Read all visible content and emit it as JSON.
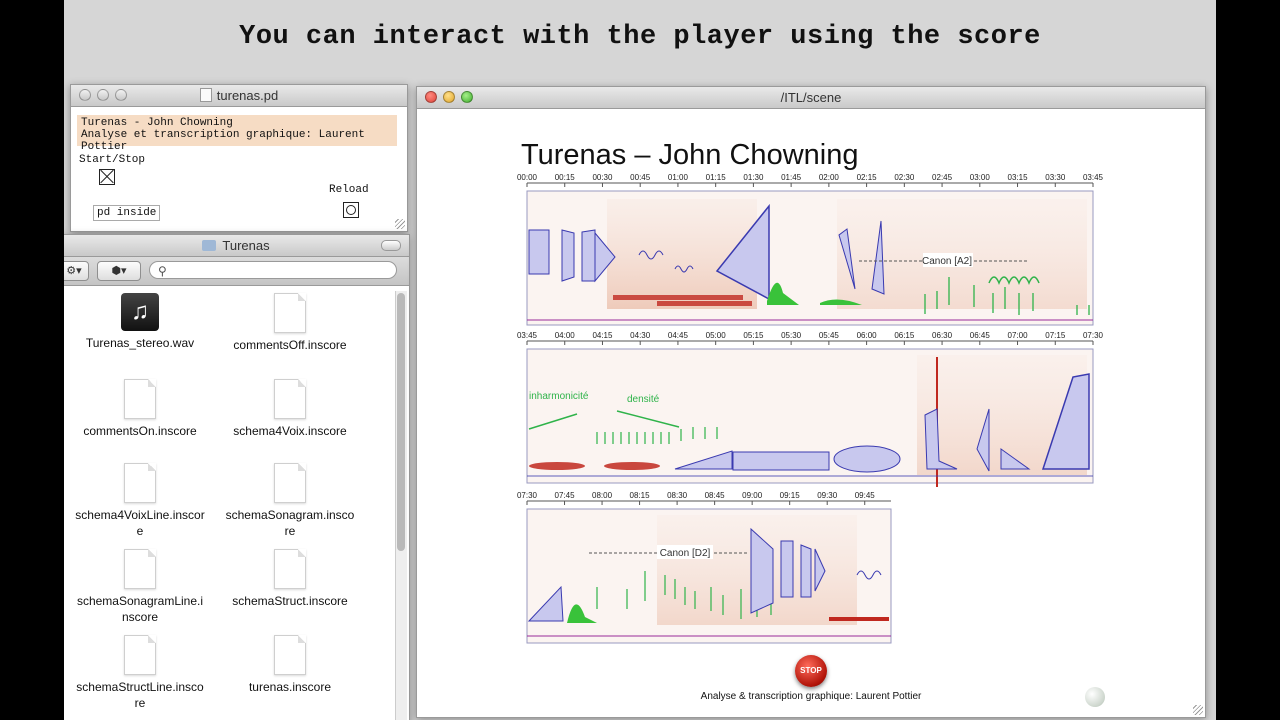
{
  "caption": "You can interact with the player using the score",
  "pd_window": {
    "title": "turenas.pd",
    "comment_line1": "Turenas - John Chowning",
    "comment_line2": "Analyse et transcription graphique: Laurent Pottier",
    "start_stop_label": "Start/Stop",
    "reload_label": "Reload",
    "object_label": "pd inside"
  },
  "finder": {
    "title": "Turenas",
    "search_placeholder": "",
    "files": [
      {
        "name": "Turenas_stereo.wav",
        "icon": "music-file-icon"
      },
      {
        "name": "commentsOff.inscore",
        "icon": "document-icon"
      },
      {
        "name": "commentsOn.inscore",
        "icon": "document-icon"
      },
      {
        "name": "schema4Voix.inscore",
        "icon": "document-icon"
      },
      {
        "name": "schema4VoixLine.inscore",
        "icon": "document-icon"
      },
      {
        "name": "schemaSonagram.inscore",
        "icon": "document-icon"
      },
      {
        "name": "schemaSonagramLine.inscore",
        "icon": "document-icon"
      },
      {
        "name": "schemaStruct.inscore",
        "icon": "document-icon"
      },
      {
        "name": "schemaStructLine.inscore",
        "icon": "document-icon"
      },
      {
        "name": "turenas.inscore",
        "icon": "document-icon"
      }
    ]
  },
  "scene": {
    "title": "/ITL/scene",
    "score_title": "Turenas – John Chowning",
    "system1_times": [
      "00:00",
      "00:15",
      "00:30",
      "00:45",
      "01:00",
      "01:15",
      "01:30",
      "01:45",
      "02:00",
      "02:15",
      "02:30",
      "02:45",
      "03:00",
      "03:15",
      "03:30",
      "03:45"
    ],
    "system2_times": [
      "03:45",
      "04:00",
      "04:15",
      "04:30",
      "04:45",
      "05:00",
      "05:15",
      "05:30",
      "05:45",
      "06:00",
      "06:15",
      "06:30",
      "06:45",
      "07:00",
      "07:15",
      "07:30"
    ],
    "system3_times": [
      "07:30",
      "07:45",
      "08:00",
      "08:15",
      "08:30",
      "08:45",
      "09:00",
      "09:15",
      "09:30",
      "09:45"
    ],
    "annotation_canon_a2": "Canon [A2]",
    "annotation_inharmonicite": "inharmonicité",
    "annotation_densite": "densité",
    "annotation_canon_d2": "Canon [D2]",
    "stop_label": "STOP",
    "footer": "Analyse & transcription graphique: Laurent Pottier"
  },
  "colors": {
    "background": "#d6d6d6",
    "score_blue": "#3a3ab0",
    "score_green": "#2fb34a",
    "score_red": "#c0281f",
    "comment_bg": "#f6dcc4"
  }
}
